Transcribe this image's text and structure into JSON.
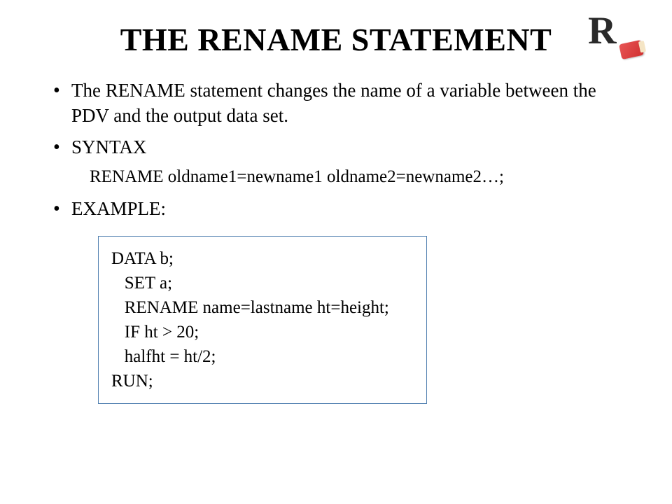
{
  "title": "THE RENAME STATEMENT",
  "logo": {
    "letter": "R",
    "semantic": "rename-eraser-icon"
  },
  "bullets": {
    "intro": "The RENAME statement changes the name of a variable between the PDV and the output data set.",
    "syntax_label": "SYNTAX",
    "syntax_text": "RENAME oldname1=newname1 oldname2=newname2…;",
    "example_label": "EXAMPLE:"
  },
  "code": {
    "line1": "DATA b;",
    "line2": "   SET a;",
    "line3": "   RENAME name=lastname ht=height;",
    "line4": "   IF ht > 20;",
    "line5": "   halfht = ht/2;",
    "line6": "RUN;"
  }
}
